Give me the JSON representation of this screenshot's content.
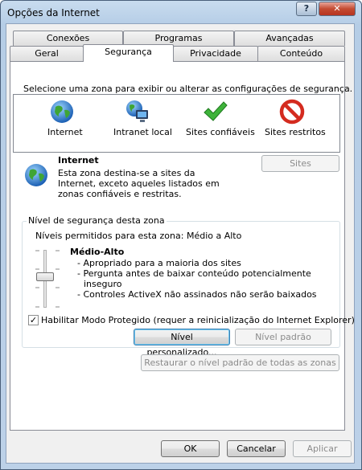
{
  "window": {
    "title": "Opções da Internet",
    "help_label": "?",
    "close_label": "✕"
  },
  "tabs": {
    "row1": [
      "Conexões",
      "Programas",
      "Avançadas"
    ],
    "row2": [
      "Geral",
      "Segurança",
      "Privacidade",
      "Conteúdo"
    ],
    "active": "Segurança"
  },
  "security": {
    "instruction": "Selecione uma zona para exibir ou alterar as configurações de segurança.",
    "zones": [
      {
        "label": "Internet",
        "icon": "globe-icon"
      },
      {
        "label": "Intranet local",
        "icon": "intranet-icon"
      },
      {
        "label": "Sites confiáveis",
        "icon": "checkmark-icon"
      },
      {
        "label": "Sites restritos",
        "icon": "restricted-icon"
      }
    ],
    "zone_title": "Internet",
    "zone_description": [
      "Esta zona destina-se a sites da",
      "Internet, exceto aqueles listados em",
      "zonas confiáveis e restritas."
    ],
    "sites_button": "Sites",
    "level_group_title": "Nível de segurança desta zona",
    "allowed_levels": "Níveis permitidos para esta zona: Médio a Alto",
    "level_name": "Médio-Alto",
    "level_bullets": [
      "- Apropriado para a maioria dos sites",
      "- Pergunta antes de baixar conteúdo potencialmente",
      "inseguro",
      "- Controles ActiveX não assinados não serão baixados"
    ],
    "protected_mode_label": "Habilitar Modo Protegido (requer a reinicialização do Internet Explorer)",
    "protected_mode_checked": true,
    "custom_level_button": "Nível personalizado...",
    "default_level_button": "Nível padrão",
    "reset_all_button": "Restaurar o nível padrão de todas as zonas"
  },
  "footer": {
    "ok": "OK",
    "cancel": "Cancelar",
    "apply": "Aplicar"
  }
}
